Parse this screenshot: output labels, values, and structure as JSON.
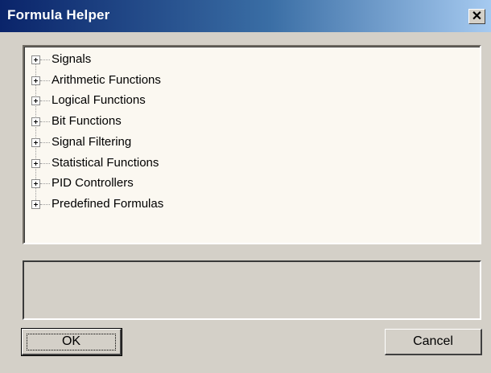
{
  "window": {
    "title": "Formula Helper",
    "close_glyph": "✕",
    "close_icon": "close-icon"
  },
  "tree": {
    "items": [
      {
        "label": "Signals",
        "expander_icon": "plus-box-icon"
      },
      {
        "label": "Arithmetic Functions",
        "expander_icon": "plus-box-icon"
      },
      {
        "label": "Logical Functions",
        "expander_icon": "plus-box-icon"
      },
      {
        "label": "Bit Functions",
        "expander_icon": "plus-box-icon"
      },
      {
        "label": "Signal Filtering",
        "expander_icon": "plus-box-icon"
      },
      {
        "label": "Statistical Functions",
        "expander_icon": "plus-box-icon"
      },
      {
        "label": "PID Controllers",
        "expander_icon": "plus-box-icon"
      },
      {
        "label": "Predefined Formulas",
        "expander_icon": "plus-box-icon"
      }
    ]
  },
  "description": {
    "text": ""
  },
  "buttons": {
    "ok_label": "OK",
    "cancel_label": "Cancel"
  },
  "colors": {
    "title_bar_start": "#0a246a",
    "title_bar_end": "#a6caf0",
    "dialog_face": "#d4d0c8",
    "tree_background": "#fbf8f1"
  }
}
